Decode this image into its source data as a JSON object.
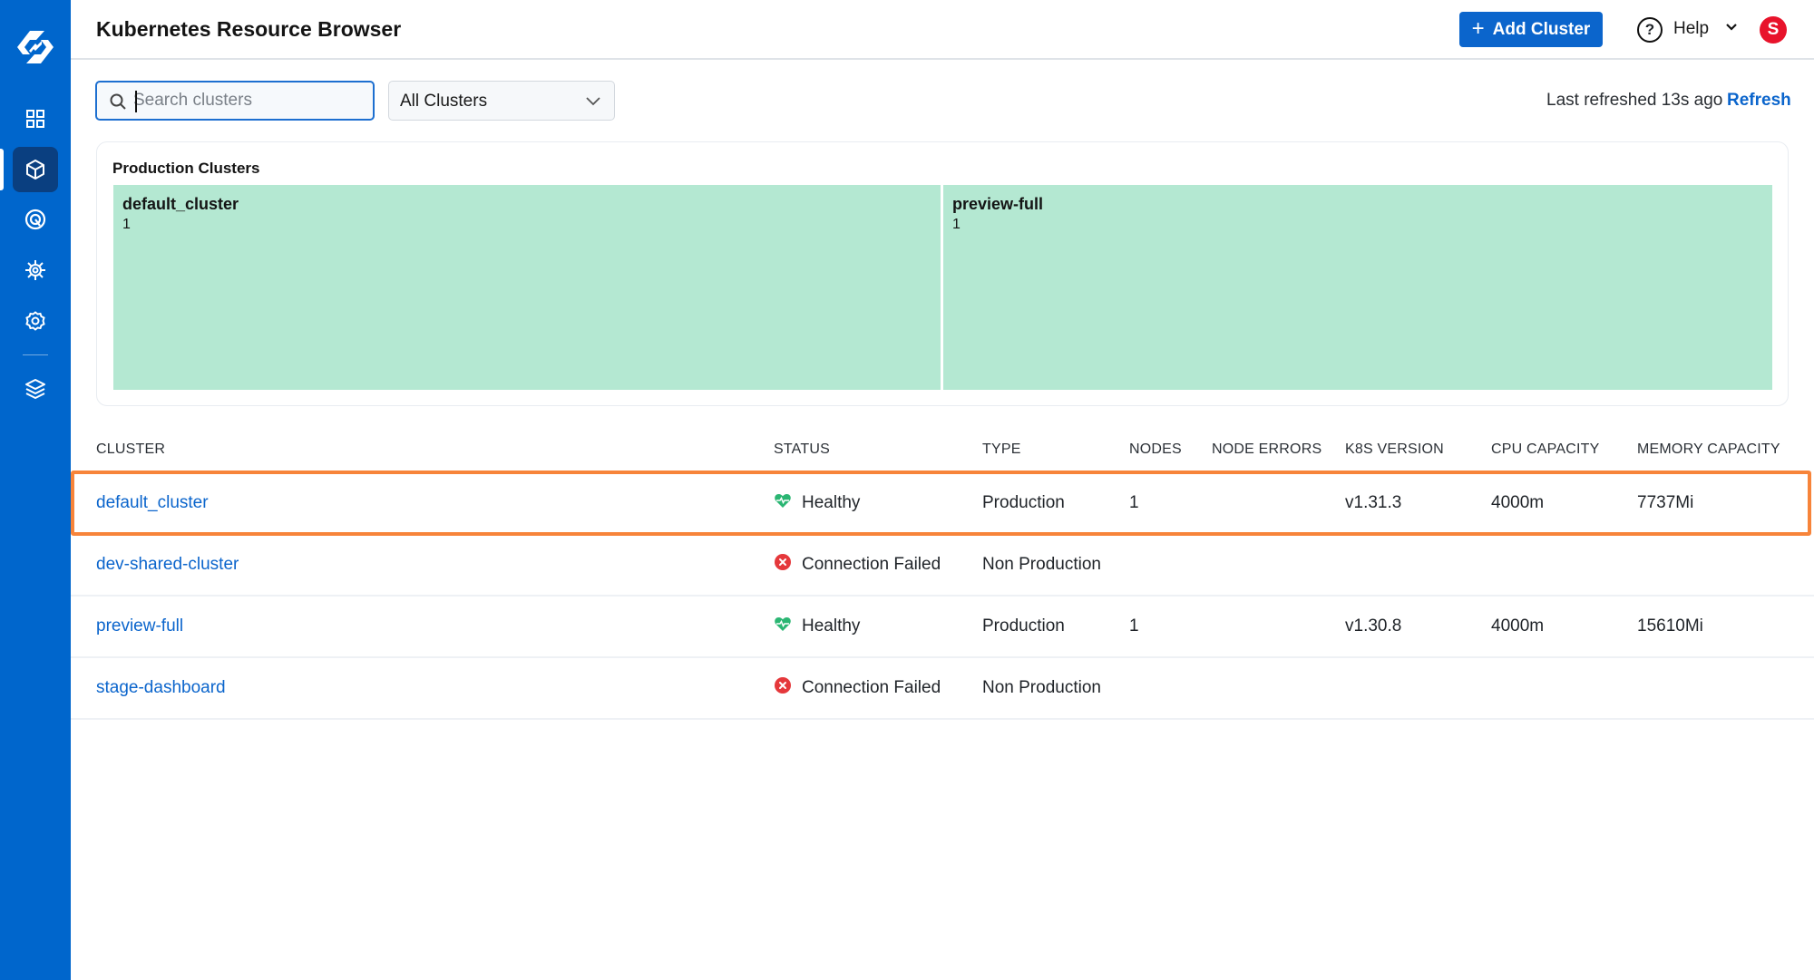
{
  "sidebar": {
    "logo": "harness-logo-icon",
    "items": [
      {
        "name": "dashboard",
        "icon": "grid-icon",
        "active": false
      },
      {
        "name": "resources",
        "icon": "cube-icon",
        "active": true
      },
      {
        "name": "monitoring",
        "icon": "target-icon",
        "active": false
      },
      {
        "name": "helm",
        "icon": "ship-wheel-icon",
        "active": false
      },
      {
        "name": "settings",
        "icon": "gear-icon",
        "active": false
      },
      {
        "name": "layers",
        "icon": "layers-icon",
        "active": false
      }
    ]
  },
  "header": {
    "title": "Kubernetes Resource Browser",
    "add_button": "Add Cluster",
    "help_label": "Help",
    "avatar_initial": "S"
  },
  "toolbar": {
    "search_placeholder": "Search clusters",
    "search_value": "",
    "filter_selected": "All Clusters",
    "last_refreshed": "Last refreshed 13s ago",
    "refresh_label": "Refresh"
  },
  "treemap": {
    "title": "Production Clusters",
    "color": "#b4e8d2",
    "cells": [
      {
        "name": "default_cluster",
        "value": "1"
      },
      {
        "name": "preview-full",
        "value": "1"
      }
    ]
  },
  "table": {
    "columns": [
      "CLUSTER",
      "STATUS",
      "TYPE",
      "NODES",
      "NODE ERRORS",
      "K8S VERSION",
      "CPU CAPACITY",
      "MEMORY CAPACITY"
    ],
    "rows": [
      {
        "cluster": "default_cluster",
        "status": "Healthy",
        "status_kind": "healthy",
        "type": "Production",
        "nodes": "1",
        "node_errors": "",
        "k8s_version": "v1.31.3",
        "cpu": "4000m",
        "memory": "7737Mi",
        "highlighted": true
      },
      {
        "cluster": "dev-shared-cluster",
        "status": "Connection Failed",
        "status_kind": "failed",
        "type": "Non Production",
        "nodes": "",
        "node_errors": "",
        "k8s_version": "",
        "cpu": "",
        "memory": "",
        "highlighted": false
      },
      {
        "cluster": "preview-full",
        "status": "Healthy",
        "status_kind": "healthy",
        "type": "Production",
        "nodes": "1",
        "node_errors": "",
        "k8s_version": "v1.30.8",
        "cpu": "4000m",
        "memory": "15610Mi",
        "highlighted": false
      },
      {
        "cluster": "stage-dashboard",
        "status": "Connection Failed",
        "status_kind": "failed",
        "type": "Non Production",
        "nodes": "",
        "node_errors": "",
        "k8s_version": "",
        "cpu": "",
        "memory": "",
        "highlighted": false
      }
    ]
  },
  "colors": {
    "sidebar": "#0066cc",
    "accent": "#0b65cc",
    "healthy": "#2bb673",
    "failed": "#e5383b",
    "highlight": "#f7843a",
    "avatar": "#e8132b"
  }
}
